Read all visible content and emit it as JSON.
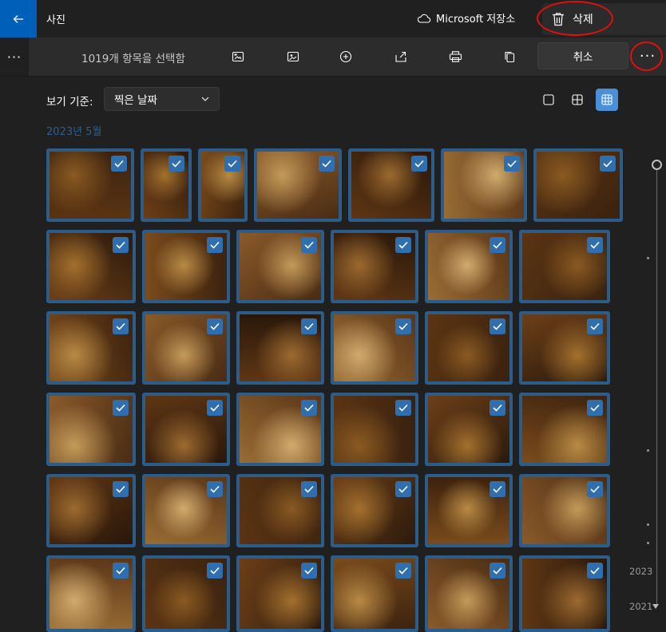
{
  "titlebar": {
    "app_title": "사진",
    "storage_label": "Microsoft 저장소",
    "delete_label": "삭제"
  },
  "cmdbar": {
    "selection_text": "1019개 항목을 선택함",
    "cancel_label": "취소",
    "more_left": "···",
    "more_right": "···",
    "icons": [
      "slideshow-icon",
      "edit-image-icon",
      "add-icon",
      "share-icon",
      "print-icon",
      "copy-icon"
    ]
  },
  "viewrow": {
    "label": "보기 기준:",
    "sort_value": "찍은 날짜"
  },
  "month_header": "2023년 5월",
  "timeline": {
    "years": [
      "2023",
      "2021"
    ]
  },
  "colors": {
    "accent": "#005fb8",
    "selection_border": "#2b5c8a",
    "checkbox": "#2f6fb0",
    "annotation": "#e01010"
  }
}
